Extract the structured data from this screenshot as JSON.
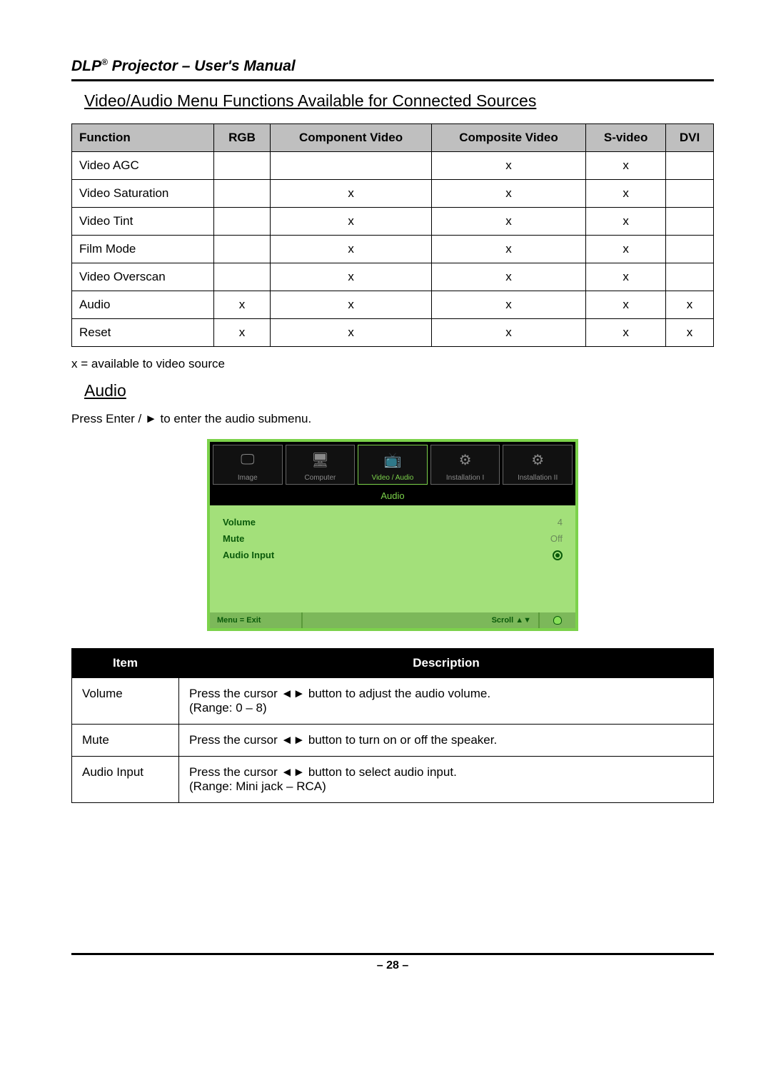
{
  "header": {
    "brand": "DLP",
    "reg": "®",
    "title_rest": " Projector – User's Manual"
  },
  "section1_heading": "Video/Audio Menu Functions Available for Connected Sources",
  "func_table": {
    "headers": [
      "Function",
      "RGB",
      "Component Video",
      "Composite Video",
      "S-video",
      "DVI"
    ],
    "rows": [
      {
        "name": "Video AGC",
        "cells": [
          "",
          "",
          "x",
          "x",
          ""
        ]
      },
      {
        "name": "Video Saturation",
        "cells": [
          "",
          "x",
          "x",
          "x",
          ""
        ]
      },
      {
        "name": "Video Tint",
        "cells": [
          "",
          "x",
          "x",
          "x",
          ""
        ]
      },
      {
        "name": "Film Mode",
        "cells": [
          "",
          "x",
          "x",
          "x",
          ""
        ]
      },
      {
        "name": "Video Overscan",
        "cells": [
          "",
          "x",
          "x",
          "x",
          ""
        ]
      },
      {
        "name": "Audio",
        "cells": [
          "x",
          "x",
          "x",
          "x",
          "x"
        ]
      },
      {
        "name": "Reset",
        "cells": [
          "x",
          "x",
          "x",
          "x",
          "x"
        ]
      }
    ]
  },
  "note": "x = available to video source",
  "audio_heading": "Audio",
  "press_text": "Press Enter / ► to enter the audio submenu.",
  "osd": {
    "tabs": [
      {
        "label": "Image",
        "icon": "🖵"
      },
      {
        "label": "Computer",
        "icon": "🖥"
      },
      {
        "label": "Video / Audio",
        "icon": "📺"
      },
      {
        "label": "Installation I",
        "icon": "⚙"
      },
      {
        "label": "Installation II",
        "icon": "⚙"
      }
    ],
    "active_tab": 2,
    "title": "Audio",
    "rows": [
      {
        "k": "Volume",
        "v": "4",
        "type": "value"
      },
      {
        "k": "Mute",
        "v": "Off",
        "type": "value"
      },
      {
        "k": "Audio Input",
        "type": "radio"
      }
    ],
    "footer": {
      "left": "Menu = Exit",
      "mid": "Scroll ▲▼"
    }
  },
  "desc_table": {
    "headers": [
      "Item",
      "Description"
    ],
    "rows": [
      {
        "item": "Volume",
        "desc": "Press the cursor ◄► button to adjust the audio volume.\n(Range: 0 – 8)"
      },
      {
        "item": "Mute",
        "desc": "Press the cursor ◄► button to turn on or off the speaker."
      },
      {
        "item": "Audio Input",
        "desc": "Press the cursor ◄► button to select audio input.\n(Range: Mini jack – RCA)"
      }
    ]
  },
  "page_number": "– 28 –"
}
